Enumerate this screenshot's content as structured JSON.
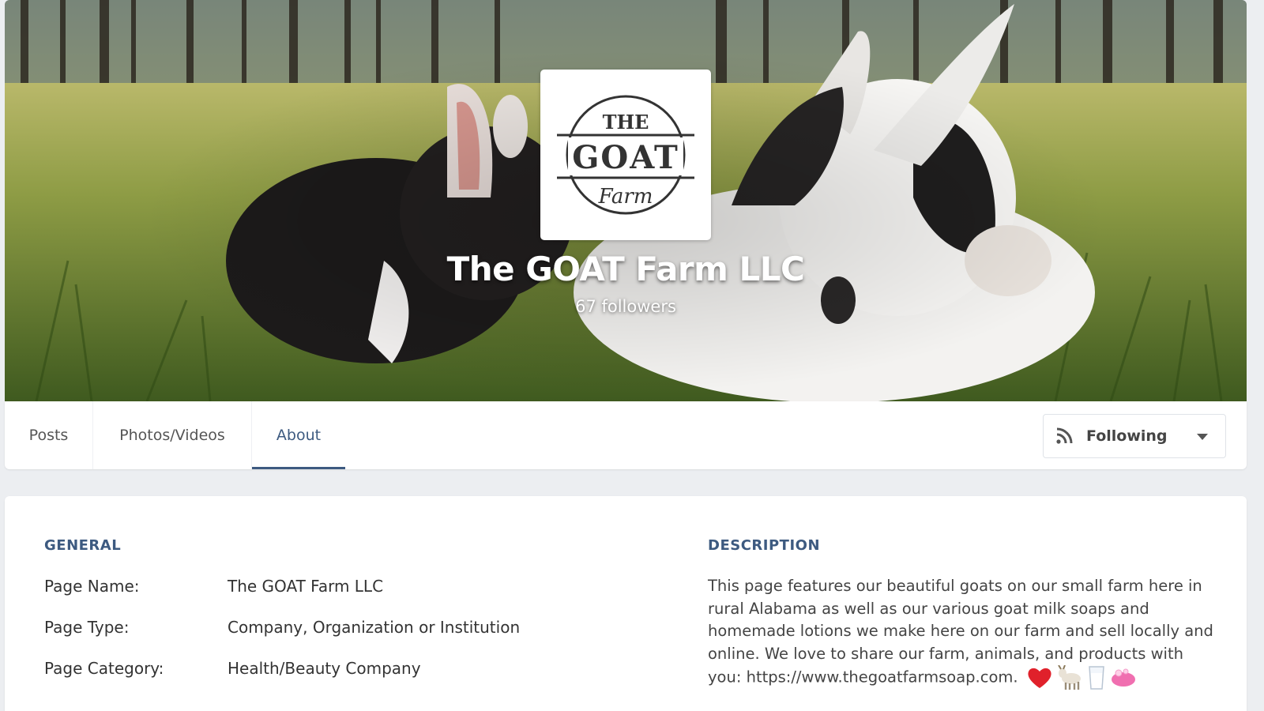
{
  "page": {
    "logo": {
      "line1": "THE",
      "line2": "GOAT",
      "line3": "Farm"
    },
    "title": "The GOAT Farm LLC",
    "followers": "67 followers"
  },
  "tabs": [
    {
      "label": "Posts",
      "active": false
    },
    {
      "label": "Photos/Videos",
      "active": false
    },
    {
      "label": "About",
      "active": true
    }
  ],
  "follow_button": {
    "label": "Following",
    "icon": "rss-icon"
  },
  "general": {
    "heading": "GENERAL",
    "rows": [
      {
        "label": "Page Name:",
        "value": "The GOAT Farm LLC"
      },
      {
        "label": "Page Type:",
        "value": "Company, Organization or Institution"
      },
      {
        "label": "Page Category:",
        "value": "Health/Beauty Company"
      }
    ]
  },
  "description": {
    "heading": "DESCRIPTION",
    "text": "This page features our beautiful goats on our small farm here in rural Alabama as well as our various goat milk soaps and homemade lotions we make here on our farm and sell locally and online. We love to share our farm, animals, and products with you: https://www.thegoatfarmsoap.com.",
    "emojis": [
      "heart-icon",
      "goat-icon",
      "milk-glass-icon",
      "soap-icon"
    ]
  },
  "colors": {
    "accent": "#3d5a80",
    "background": "#eceef1",
    "heart": "#e0212b"
  }
}
